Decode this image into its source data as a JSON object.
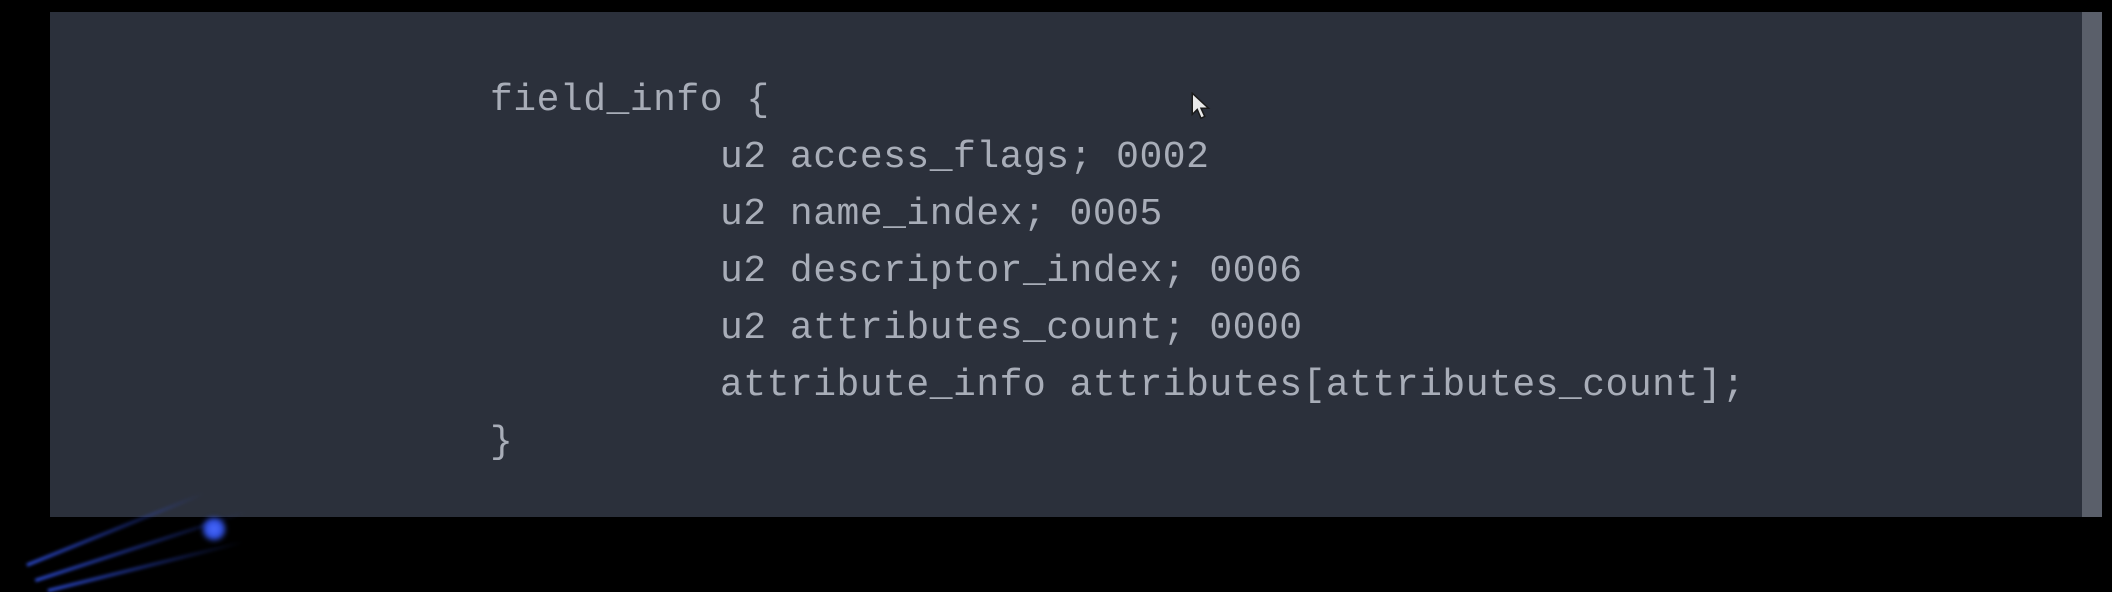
{
  "code": {
    "line1": "field_info {",
    "line2": "u2 access_flags; 0002",
    "line3": "u2 name_index; 0005",
    "line4": "u2 descriptor_index; 0006",
    "line5": "u2 attributes_count; 0000",
    "line6": "attribute_info attributes[attributes_count];",
    "line7": "}"
  }
}
